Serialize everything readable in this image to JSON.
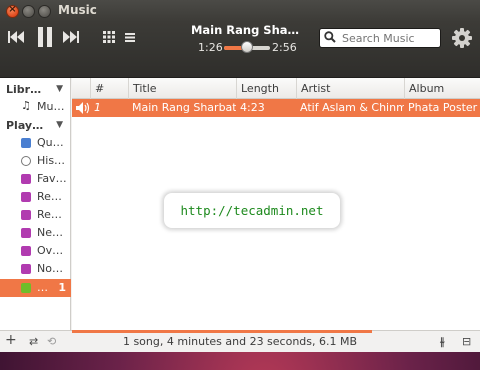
{
  "window": {
    "title": "Music"
  },
  "toolbar": {
    "now_playing": "Main Rang Sha…",
    "time_elapsed": "1:26",
    "time_total": "2:56",
    "seek_progress": 0.49,
    "search_placeholder": "Search Music"
  },
  "sidebar": {
    "library_header": "Libr…",
    "library_items": [
      {
        "label": "Mu…",
        "icon": "music-note-icon"
      }
    ],
    "playlists_header": "Play…",
    "playlist_items": [
      {
        "label": "Qu…",
        "icon": "queue-icon",
        "color": "#4a7fd1"
      },
      {
        "label": "His…",
        "icon": "history-icon",
        "color": "#888888"
      },
      {
        "label": "Fav…",
        "icon": "playlist-icon",
        "color": "#b13bb0"
      },
      {
        "label": "Re…",
        "icon": "playlist-icon",
        "color": "#b13bb0"
      },
      {
        "label": "Re…",
        "icon": "playlist-icon",
        "color": "#b13bb0"
      },
      {
        "label": "Ne…",
        "icon": "playlist-icon",
        "color": "#b13bb0"
      },
      {
        "label": "Ov…",
        "icon": "playlist-icon",
        "color": "#b13bb0"
      },
      {
        "label": "No…",
        "icon": "playlist-icon",
        "color": "#b13bb0"
      }
    ],
    "active_item": {
      "label": "…",
      "count": "1",
      "icon": "add-playlist-icon",
      "color": "#6fbd2a"
    }
  },
  "columns": [
    "#",
    "Title",
    "Length",
    "Artist",
    "Album"
  ],
  "tracks": [
    {
      "number": "1",
      "title": "Main Rang Sharbato",
      "length": "4:23",
      "artist": "Atif Aslam & Chinm",
      "album": "Phata Poster"
    }
  ],
  "overlay": {
    "url": "http://tecadmin.net"
  },
  "status": {
    "text": "1 song, 4 minutes and 23 seconds, 6.1 MB"
  },
  "colors": {
    "accent": "#f07746",
    "toolbar": "#3c3b37",
    "url_text": "#1e8a1e"
  }
}
